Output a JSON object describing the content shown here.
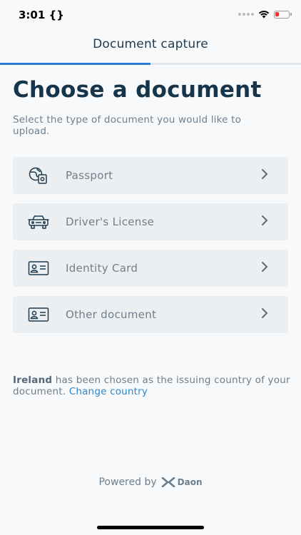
{
  "status_bar": {
    "time": "3:01 {}"
  },
  "header": {
    "title": "Document capture",
    "progress_percent": 50
  },
  "page": {
    "title": "Choose a document",
    "subtitle": "Select the type of document you would like to upload."
  },
  "options": [
    {
      "label": "Passport",
      "icon": "passport-icon"
    },
    {
      "label": "Driver's License",
      "icon": "car-icon"
    },
    {
      "label": "Identity Card",
      "icon": "id-card-icon"
    },
    {
      "label": "Other document",
      "icon": "id-card-icon"
    }
  ],
  "info": {
    "country": "Ireland",
    "text": " has been chosen as the issuing country of your document. ",
    "change_link": "Change country"
  },
  "footer": {
    "powered_by": "Powered by",
    "brand": "Daon"
  },
  "colors": {
    "accent": "#2a7fd4",
    "link": "#2a86c9",
    "title": "#16344a"
  }
}
